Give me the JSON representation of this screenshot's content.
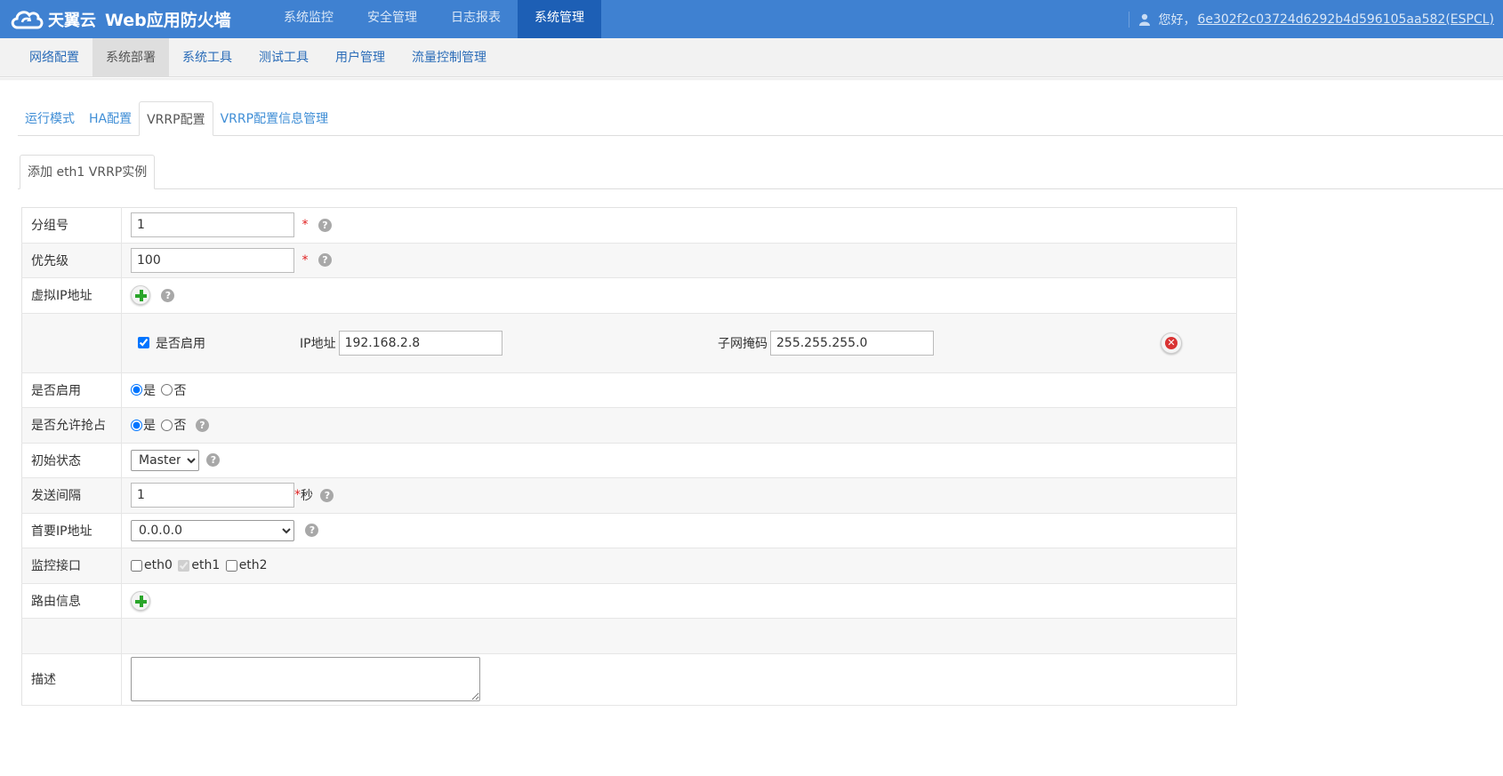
{
  "header": {
    "brand": "天翼云",
    "product": "Web应用防火墙",
    "nav": [
      {
        "label": "系统监控",
        "active": false
      },
      {
        "label": "安全管理",
        "active": false
      },
      {
        "label": "日志报表",
        "active": false
      },
      {
        "label": "系统管理",
        "active": true
      }
    ],
    "greeting": "您好，",
    "username": "6e302f2c03724d6292b4d596105aa582(ESPCL)"
  },
  "subnav": [
    {
      "label": "网络配置",
      "active": false
    },
    {
      "label": "系统部署",
      "active": true
    },
    {
      "label": "系统工具",
      "active": false
    },
    {
      "label": "测试工具",
      "active": false
    },
    {
      "label": "用户管理",
      "active": false
    },
    {
      "label": "流量控制管理",
      "active": false
    }
  ],
  "tabs": [
    {
      "label": "运行模式",
      "active": false
    },
    {
      "label": "HA配置",
      "active": false
    },
    {
      "label": "VRRP配置",
      "active": true
    },
    {
      "label": "VRRP配置信息管理",
      "active": false
    }
  ],
  "subtab": "添加 eth1 VRRP实例",
  "form": {
    "group_label": "分组号",
    "group_value": "1",
    "priority_label": "优先级",
    "priority_value": "100",
    "required_mark": "*",
    "help_glyph": "?",
    "vip_label": "虚拟IP地址",
    "vip_entry": {
      "enabled_label": "是否启用",
      "enabled": true,
      "ip_label": "IP地址",
      "ip_value": "192.168.2.8",
      "mask_label": "子网掩码",
      "mask_value": "255.255.255.0",
      "delete_glyph": "✕"
    },
    "enable_label": "是否启用",
    "preempt_label": "是否允许抢占",
    "yes": "是",
    "no": "否",
    "init_state_label": "初始状态",
    "init_state_value": "Master",
    "interval_label": "发送间隔",
    "interval_value": "1",
    "interval_unit": "秒",
    "primary_ip_label": "首要IP地址",
    "primary_ip_value": "0.0.0.0",
    "monitor_label": "监控接口",
    "interfaces": [
      {
        "name": "eth0",
        "checked": false,
        "disabled": false
      },
      {
        "name": "eth1",
        "checked": true,
        "disabled": true
      },
      {
        "name": "eth2",
        "checked": false,
        "disabled": false
      }
    ],
    "route_label": "路由信息",
    "desc_label": "描述",
    "desc_value": ""
  }
}
